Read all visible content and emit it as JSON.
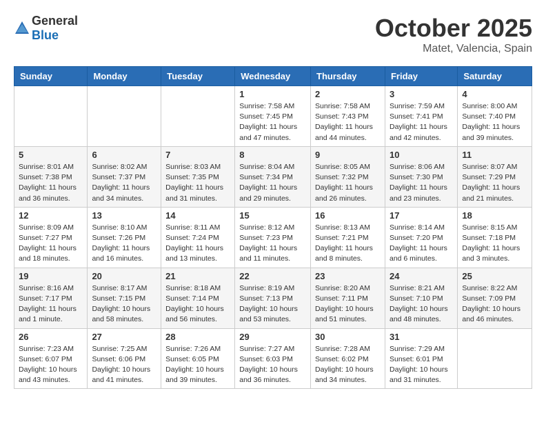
{
  "header": {
    "logo_general": "General",
    "logo_blue": "Blue",
    "month": "October 2025",
    "location": "Matet, Valencia, Spain"
  },
  "weekdays": [
    "Sunday",
    "Monday",
    "Tuesday",
    "Wednesday",
    "Thursday",
    "Friday",
    "Saturday"
  ],
  "weeks": [
    [
      {
        "day": "",
        "info": ""
      },
      {
        "day": "",
        "info": ""
      },
      {
        "day": "",
        "info": ""
      },
      {
        "day": "1",
        "info": "Sunrise: 7:58 AM\nSunset: 7:45 PM\nDaylight: 11 hours\nand 47 minutes."
      },
      {
        "day": "2",
        "info": "Sunrise: 7:58 AM\nSunset: 7:43 PM\nDaylight: 11 hours\nand 44 minutes."
      },
      {
        "day": "3",
        "info": "Sunrise: 7:59 AM\nSunset: 7:41 PM\nDaylight: 11 hours\nand 42 minutes."
      },
      {
        "day": "4",
        "info": "Sunrise: 8:00 AM\nSunset: 7:40 PM\nDaylight: 11 hours\nand 39 minutes."
      }
    ],
    [
      {
        "day": "5",
        "info": "Sunrise: 8:01 AM\nSunset: 7:38 PM\nDaylight: 11 hours\nand 36 minutes."
      },
      {
        "day": "6",
        "info": "Sunrise: 8:02 AM\nSunset: 7:37 PM\nDaylight: 11 hours\nand 34 minutes."
      },
      {
        "day": "7",
        "info": "Sunrise: 8:03 AM\nSunset: 7:35 PM\nDaylight: 11 hours\nand 31 minutes."
      },
      {
        "day": "8",
        "info": "Sunrise: 8:04 AM\nSunset: 7:34 PM\nDaylight: 11 hours\nand 29 minutes."
      },
      {
        "day": "9",
        "info": "Sunrise: 8:05 AM\nSunset: 7:32 PM\nDaylight: 11 hours\nand 26 minutes."
      },
      {
        "day": "10",
        "info": "Sunrise: 8:06 AM\nSunset: 7:30 PM\nDaylight: 11 hours\nand 23 minutes."
      },
      {
        "day": "11",
        "info": "Sunrise: 8:07 AM\nSunset: 7:29 PM\nDaylight: 11 hours\nand 21 minutes."
      }
    ],
    [
      {
        "day": "12",
        "info": "Sunrise: 8:09 AM\nSunset: 7:27 PM\nDaylight: 11 hours\nand 18 minutes."
      },
      {
        "day": "13",
        "info": "Sunrise: 8:10 AM\nSunset: 7:26 PM\nDaylight: 11 hours\nand 16 minutes."
      },
      {
        "day": "14",
        "info": "Sunrise: 8:11 AM\nSunset: 7:24 PM\nDaylight: 11 hours\nand 13 minutes."
      },
      {
        "day": "15",
        "info": "Sunrise: 8:12 AM\nSunset: 7:23 PM\nDaylight: 11 hours\nand 11 minutes."
      },
      {
        "day": "16",
        "info": "Sunrise: 8:13 AM\nSunset: 7:21 PM\nDaylight: 11 hours\nand 8 minutes."
      },
      {
        "day": "17",
        "info": "Sunrise: 8:14 AM\nSunset: 7:20 PM\nDaylight: 11 hours\nand 6 minutes."
      },
      {
        "day": "18",
        "info": "Sunrise: 8:15 AM\nSunset: 7:18 PM\nDaylight: 11 hours\nand 3 minutes."
      }
    ],
    [
      {
        "day": "19",
        "info": "Sunrise: 8:16 AM\nSunset: 7:17 PM\nDaylight: 11 hours\nand 1 minute."
      },
      {
        "day": "20",
        "info": "Sunrise: 8:17 AM\nSunset: 7:15 PM\nDaylight: 10 hours\nand 58 minutes."
      },
      {
        "day": "21",
        "info": "Sunrise: 8:18 AM\nSunset: 7:14 PM\nDaylight: 10 hours\nand 56 minutes."
      },
      {
        "day": "22",
        "info": "Sunrise: 8:19 AM\nSunset: 7:13 PM\nDaylight: 10 hours\nand 53 minutes."
      },
      {
        "day": "23",
        "info": "Sunrise: 8:20 AM\nSunset: 7:11 PM\nDaylight: 10 hours\nand 51 minutes."
      },
      {
        "day": "24",
        "info": "Sunrise: 8:21 AM\nSunset: 7:10 PM\nDaylight: 10 hours\nand 48 minutes."
      },
      {
        "day": "25",
        "info": "Sunrise: 8:22 AM\nSunset: 7:09 PM\nDaylight: 10 hours\nand 46 minutes."
      }
    ],
    [
      {
        "day": "26",
        "info": "Sunrise: 7:23 AM\nSunset: 6:07 PM\nDaylight: 10 hours\nand 43 minutes."
      },
      {
        "day": "27",
        "info": "Sunrise: 7:25 AM\nSunset: 6:06 PM\nDaylight: 10 hours\nand 41 minutes."
      },
      {
        "day": "28",
        "info": "Sunrise: 7:26 AM\nSunset: 6:05 PM\nDaylight: 10 hours\nand 39 minutes."
      },
      {
        "day": "29",
        "info": "Sunrise: 7:27 AM\nSunset: 6:03 PM\nDaylight: 10 hours\nand 36 minutes."
      },
      {
        "day": "30",
        "info": "Sunrise: 7:28 AM\nSunset: 6:02 PM\nDaylight: 10 hours\nand 34 minutes."
      },
      {
        "day": "31",
        "info": "Sunrise: 7:29 AM\nSunset: 6:01 PM\nDaylight: 10 hours\nand 31 minutes."
      },
      {
        "day": "",
        "info": ""
      }
    ]
  ]
}
